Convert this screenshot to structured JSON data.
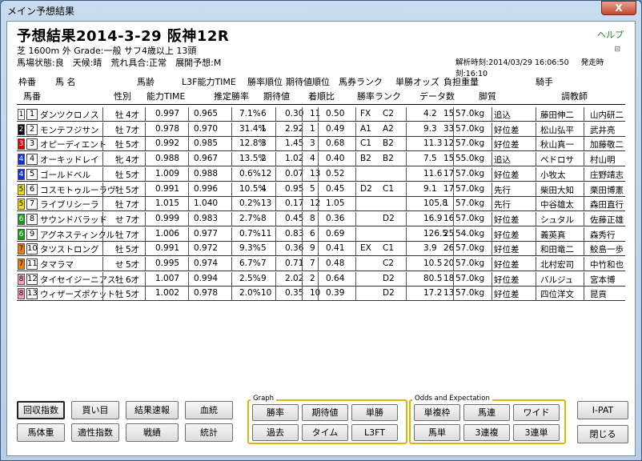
{
  "window": {
    "title": "メイン予想結果",
    "close_label": "X"
  },
  "header": {
    "title": "予想結果2014-3-29 阪神12R",
    "help": "ヘルプ",
    "mini_icon": "⊟",
    "race_info": "芝 1600m 外 Grade:一般 サフ4歳以上 13頭",
    "track_info": "馬場状態:良　天候:晴　荒れ具合:正常　展開予想:M",
    "analysis_time": "解析時刻:2014/03/29 16:06:50",
    "post_time": "発走時刻:16:10"
  },
  "columns_top": [
    "枠番",
    "馬 名",
    "馬齢",
    "L3F能力TIME",
    "勝率順位",
    "期待値順位",
    "馬券ランク",
    "単勝オッズ",
    "負担重量",
    "騎手"
  ],
  "columns_bottom": [
    "馬番",
    "性別",
    "能力TIME",
    "推定勝率",
    "期待値",
    "着順比",
    "勝率ランク",
    "データ数",
    "脚質",
    "調教師"
  ],
  "rows": [
    {
      "waku": "1",
      "ban": "1",
      "name": "ダンツクロノス",
      "sex": "牡",
      "age": "4才",
      "t1": "0.997",
      "t2": "0.965",
      "win": "7.1%",
      "wr": "6",
      "ev": "0.30",
      "er": "11",
      "ratio": "0.50",
      "rank1": "FX",
      "rank2": "C2",
      "odds": "4.2",
      "n": "15",
      "wt": "57.0kg",
      "style": "追込",
      "jockey": "藤田伸二",
      "trainer": "山内研二",
      "wcolor": "#ffffff"
    },
    {
      "waku": "2",
      "ban": "2",
      "name": "モンテフジサン",
      "sex": "牡",
      "age": "7才",
      "t1": "0.978",
      "t2": "0.970",
      "win": "31.4%",
      "wr": "1",
      "ev": "2.92",
      "er": "1",
      "ratio": "0.49",
      "rank1": "A1",
      "rank2": "A2",
      "odds": "9.3",
      "n": "33",
      "wt": "57.0kg",
      "style": "好位差",
      "jockey": "松山弘平",
      "trainer": "武井亮",
      "wcolor": "#000000"
    },
    {
      "waku": "3",
      "ban": "3",
      "name": "オピーディエント",
      "sex": "牡",
      "age": "5才",
      "t1": "0.992",
      "t2": "0.985",
      "win": "12.8%",
      "wr": "3",
      "ev": "1.45",
      "er": "3",
      "ratio": "0.68",
      "rank1": "C1",
      "rank2": "B2",
      "odds": "11.3",
      "n": "12",
      "wt": "57.0kg",
      "style": "好位差",
      "jockey": "秋山真一",
      "trainer": "加藤敬二",
      "wcolor": "#e00000"
    },
    {
      "waku": "4",
      "ban": "4",
      "name": "オーキッドレイ",
      "sex": "牝",
      "age": "4才",
      "t1": "0.988",
      "t2": "0.967",
      "win": "13.5%",
      "wr": "2",
      "ev": "1.02",
      "er": "4",
      "ratio": "0.40",
      "rank1": "B2",
      "rank2": "B2",
      "odds": "7.5",
      "n": "15",
      "wt": "55.0kg",
      "style": "追込",
      "jockey": "ペドロサ",
      "trainer": "村山明",
      "wcolor": "#1030e0"
    },
    {
      "waku": "4",
      "ban": "5",
      "name": "ゴールドベル",
      "sex": "牡",
      "age": "5才",
      "t1": "1.009",
      "t2": "0.988",
      "win": "0.6%",
      "wr": "12",
      "ev": "0.07",
      "er": "13",
      "ratio": "0.52",
      "rank1": "",
      "rank2": "",
      "odds": "11.6",
      "n": "17",
      "wt": "57.0kg",
      "style": "好位差",
      "jockey": "小牧太",
      "trainer": "庄野靖志",
      "wcolor": "#1030e0"
    },
    {
      "waku": "5",
      "ban": "6",
      "name": "コスモトゥルーラヴ",
      "sex": "牡",
      "age": "5才",
      "t1": "0.991",
      "t2": "0.996",
      "win": "10.5%",
      "wr": "4",
      "ev": "0.95",
      "er": "5",
      "ratio": "0.45",
      "rank1": "D2",
      "rank2": "C1",
      "odds": "9.1",
      "n": "17",
      "wt": "57.0kg",
      "style": "先行",
      "jockey": "柴田大知",
      "trainer": "栗田博憲",
      "wcolor": "#f0e000"
    },
    {
      "waku": "5",
      "ban": "7",
      "name": "ライブリシーラ",
      "sex": "牡",
      "age": "7才",
      "t1": "1.015",
      "t2": "1.040",
      "win": "0.2%",
      "wr": "13",
      "ev": "0.17",
      "er": "12",
      "ratio": "1.05",
      "rank1": "",
      "rank2": "",
      "odds": "105.8",
      "n": "1",
      "wt": "57.0kg",
      "style": "先行",
      "jockey": "中谷雄太",
      "trainer": "森田直行",
      "wcolor": "#f0e000"
    },
    {
      "waku": "6",
      "ban": "8",
      "name": "サウンドバラッド",
      "sex": "せ",
      "age": "7才",
      "t1": "0.999",
      "t2": "0.983",
      "win": "2.7%",
      "wr": "8",
      "ev": "0.45",
      "er": "8",
      "ratio": "0.36",
      "rank1": "",
      "rank2": "D2",
      "odds": "16.9",
      "n": "16",
      "wt": "57.0kg",
      "style": "好位差",
      "jockey": "シュタル",
      "trainer": "佐藤正雄",
      "wcolor": "#10a010"
    },
    {
      "waku": "6",
      "ban": "9",
      "name": "アグネスティンクル",
      "sex": "牡",
      "age": "7才",
      "t1": "1.006",
      "t2": "0.977",
      "win": "0.7%",
      "wr": "11",
      "ev": "0.83",
      "er": "6",
      "ratio": "0.69",
      "rank1": "",
      "rank2": "",
      "odds": "126.5",
      "n": "25",
      "wt": "54.0kg",
      "style": "好位差",
      "jockey": "義英真",
      "trainer": "森秀行",
      "wcolor": "#10a010"
    },
    {
      "waku": "7",
      "ban": "10",
      "name": "タツストロング",
      "sex": "牡",
      "age": "5才",
      "t1": "0.991",
      "t2": "0.972",
      "win": "9.3%",
      "wr": "5",
      "ev": "0.36",
      "er": "9",
      "ratio": "0.41",
      "rank1": "EX",
      "rank2": "C1",
      "odds": "3.9",
      "n": "26",
      "wt": "57.0kg",
      "style": "好位差",
      "jockey": "和田竜二",
      "trainer": "鮫島一歩",
      "wcolor": "#f08000"
    },
    {
      "waku": "7",
      "ban": "11",
      "name": "タマラマ",
      "sex": "せ",
      "age": "5才",
      "t1": "0.995",
      "t2": "0.974",
      "win": "6.7%",
      "wr": "7",
      "ev": "0.71",
      "er": "7",
      "ratio": "0.48",
      "rank1": "",
      "rank2": "C2",
      "odds": "10.5",
      "n": "20",
      "wt": "57.0kg",
      "style": "好位差",
      "jockey": "北村宏司",
      "trainer": "中竹和也",
      "wcolor": "#f08000"
    },
    {
      "waku": "8",
      "ban": "12",
      "name": "タイセイジーニアス",
      "sex": "牡",
      "age": "6才",
      "t1": "1.007",
      "t2": "0.994",
      "win": "2.5%",
      "wr": "9",
      "ev": "2.02",
      "er": "2",
      "ratio": "0.64",
      "rank1": "",
      "rank2": "D2",
      "odds": "80.5",
      "n": "18",
      "wt": "57.0kg",
      "style": "好位差",
      "jockey": "バルジュ",
      "trainer": "宮本博",
      "wcolor": "#f4a0b8"
    },
    {
      "waku": "8",
      "ban": "13",
      "name": "ウィザーズポケット",
      "sex": "牡",
      "age": "5才",
      "t1": "1.002",
      "t2": "0.978",
      "win": "2.0%",
      "wr": "10",
      "ev": "0.35",
      "er": "10",
      "ratio": "0.39",
      "rank1": "",
      "rank2": "D2",
      "odds": "17.2",
      "n": "13",
      "wt": "57.0kg",
      "style": "好位差",
      "jockey": "四位洋文",
      "trainer": "昆貢",
      "wcolor": "#f4a0b8"
    }
  ],
  "buttons": {
    "kaishu": "回収指数",
    "kaime": "買い目",
    "kekka": "結果速報",
    "kettou": "血統",
    "bataiju": "馬体重",
    "tekisei": "適性指数",
    "senseki": "戦績",
    "toukei": "統計",
    "ipat": "I-PAT",
    "close": "閉じる"
  },
  "graph_group": {
    "label": "Graph",
    "buttons": [
      "勝率",
      "期待値",
      "単勝",
      "過去",
      "タイム",
      "L3FT"
    ]
  },
  "odds_group": {
    "label": "Odds and Expectation",
    "buttons": [
      "単複枠",
      "馬連",
      "ワイド",
      "馬単",
      "3連複",
      "3連単"
    ]
  }
}
